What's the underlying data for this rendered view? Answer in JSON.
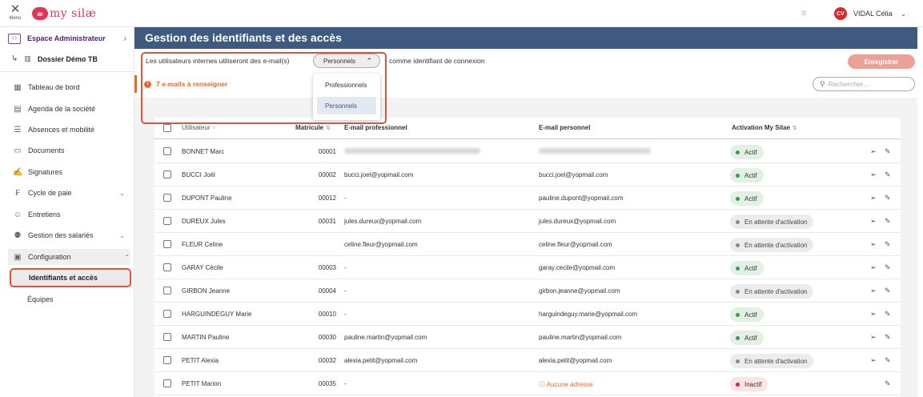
{
  "topbar": {
    "menu_label": "Menu",
    "logo_mark": "æ",
    "logo_text": "my silæ",
    "user_initials": "CV",
    "user_name": "VIDAL Célia",
    "colors": {
      "brand": "#e4335a",
      "avatar": "#d42b2b",
      "accent": "#e66a2c"
    }
  },
  "sidebar": {
    "espace": "Espace Administrateur",
    "dossier": "Dossier Démo TB",
    "items": [
      {
        "label": "Tableau de bord",
        "icon": "dashboard-icon"
      },
      {
        "label": "Agenda de la société",
        "icon": "calendar-icon"
      },
      {
        "label": "Absences et mobilité",
        "icon": "list-icon"
      },
      {
        "label": "Documents",
        "icon": "folder-icon"
      },
      {
        "label": "Signatures",
        "icon": "signature-icon"
      },
      {
        "label": "Cycle de paie",
        "icon": "payroll-icon"
      },
      {
        "label": "Entretiens",
        "icon": "interview-icon"
      },
      {
        "label": "Gestion des salariés",
        "icon": "employees-icon"
      },
      {
        "label": "Configuration",
        "icon": "config-icon"
      }
    ],
    "sub_items": [
      "Identifiants et accès",
      "Équipes"
    ]
  },
  "page": {
    "title": "Gestion des identifiants et des accès",
    "setting_prefix": "Les utilisateurs internes utiliseront des e-mail(s)",
    "setting_value": "Personnels",
    "setting_suffix": "comme identifiant de connexion",
    "options": [
      "Professionnels",
      "Personnels"
    ],
    "warning": "7 e-mails à renseigner",
    "save_label": "Enregistrer",
    "search_placeholder": "Rechercher...",
    "header_color": "#3e5a7e"
  },
  "table": {
    "headers": {
      "user": "Utilisateur",
      "matricule": "Matricule",
      "email_pro": "E-mail professionnel",
      "email_perso": "E-mail personnel",
      "activation": "Activation My Silae"
    },
    "rows": [
      {
        "name": "BONNET Marc",
        "mat": "00001",
        "pro": "",
        "perso": "",
        "status": "Actif",
        "kind": "actif",
        "send": true,
        "blurred": true
      },
      {
        "name": "BUCCI Joël",
        "mat": "00002",
        "pro": "bucci.joel@yopmail.com",
        "perso": "bucci.joel@yopmail.com",
        "status": "Actif",
        "kind": "actif",
        "send": true
      },
      {
        "name": "DUPONT Pauline",
        "mat": "00012",
        "pro": "-",
        "perso": "pauline.dupont@yopmail.com",
        "status": "Actif",
        "kind": "actif",
        "send": true
      },
      {
        "name": "DUREUX Jules",
        "mat": "00031",
        "pro": "jules.dureux@yopmail.com",
        "perso": "jules.dureux@yopmail.com",
        "status": "En attente d'activation",
        "kind": "wait",
        "send": true
      },
      {
        "name": "FLEUR Celine",
        "mat": "",
        "pro": "celine.fleur@yopmail.com",
        "perso": "celine.fleur@yopmail.com",
        "status": "En attente d'activation",
        "kind": "wait",
        "send": true
      },
      {
        "name": "GARAY Cécile",
        "mat": "00003",
        "pro": "-",
        "perso": "garay.cecile@yopmail.com",
        "status": "Actif",
        "kind": "actif",
        "send": true
      },
      {
        "name": "GIRBON Jeanne",
        "mat": "00004",
        "pro": "-",
        "perso": "girbon.jeanne@yopmail.com",
        "status": "En attente d'activation",
        "kind": "wait",
        "send": true
      },
      {
        "name": "HARGUINDEGUY Marie",
        "mat": "00010",
        "pro": "-",
        "perso": "harguindeguy.marie@yopmail.com",
        "status": "Actif",
        "kind": "actif",
        "send": true
      },
      {
        "name": "MARTIN Pauline",
        "mat": "00030",
        "pro": "pauline.martin@yopmail.com",
        "perso": "pauline.martin@yopmail.com",
        "status": "Actif",
        "kind": "actif",
        "send": true
      },
      {
        "name": "PETIT Alexia",
        "mat": "00032",
        "pro": "alexia.petit@yopmail.com",
        "perso": "alexia.petit@yopmail.com",
        "status": "En attente d'activation",
        "kind": "wait",
        "send": true
      },
      {
        "name": "PETIT Marion",
        "mat": "00035",
        "pro": "-",
        "perso": "Aucune adresse",
        "status": "Inactif",
        "kind": "inactif",
        "send": false,
        "no_addr": true
      }
    ]
  }
}
